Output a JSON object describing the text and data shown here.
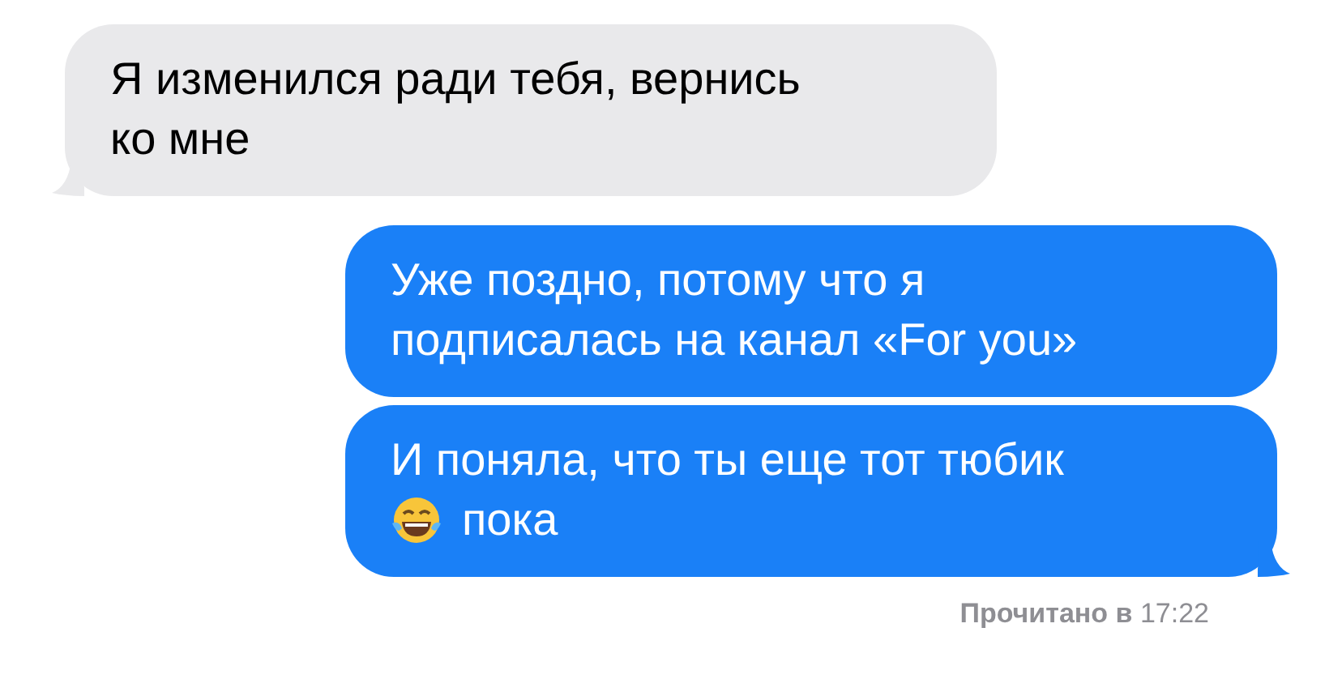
{
  "messages": [
    {
      "outgoing": false,
      "tail": true,
      "lines": [
        [
          {
            "kind": "text",
            "text": "Я изменился ради тебя, вернись"
          }
        ],
        [
          {
            "kind": "text",
            "text": "ко мне"
          }
        ]
      ]
    },
    {
      "outgoing": true,
      "tail": false,
      "lines": [
        [
          {
            "kind": "text",
            "text": "Уже поздно, потому что я"
          }
        ],
        [
          {
            "kind": "text",
            "text": "подписалась на канал «For you»"
          }
        ]
      ]
    },
    {
      "outgoing": true,
      "tail": true,
      "lines": [
        [
          {
            "kind": "text",
            "text": "И поняла, что ты еще тот тюбик"
          }
        ],
        [
          {
            "kind": "emoji"
          },
          {
            "kind": "text",
            "text": "пока"
          }
        ]
      ]
    }
  ],
  "read_receipt": "**Прочитано в** 17:22"
}
